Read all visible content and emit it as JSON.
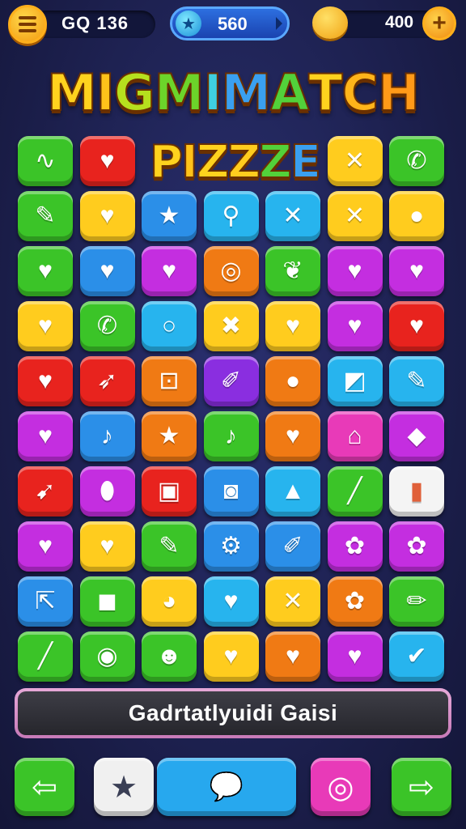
{
  "header": {
    "score_text": "GQ 136",
    "gems_value": "560",
    "coins_value": "400",
    "menu_icon": "hamburger-menu-icon",
    "gem_icon": "star-gem-icon",
    "coin_icon": "gold-coin-icon",
    "plus_label": "+"
  },
  "title": {
    "line1": "MIGMIMATCH",
    "line2": "PIZZZE"
  },
  "board": {
    "rows": 10,
    "cols": 7,
    "tiles": [
      [
        {
          "color": "#3bc428",
          "icon": "swirl-icon",
          "glyph": "∿"
        },
        {
          "color": "#e8231e",
          "icon": "heart-icon",
          "glyph": "♥"
        },
        {
          "color": "#ffd418",
          "icon": "title-overlap",
          "glyph": ""
        },
        {
          "color": "#ffd418",
          "icon": "title-overlap",
          "glyph": ""
        },
        {
          "color": "#ffd418",
          "icon": "title-overlap",
          "glyph": ""
        },
        {
          "color": "#ffcc1e",
          "icon": "cross-icon",
          "glyph": "✕"
        },
        {
          "color": "#3bc428",
          "icon": "phone-icon",
          "glyph": "✆"
        }
      ],
      [
        {
          "color": "#3bc428",
          "icon": "pencil-icon",
          "glyph": "✎"
        },
        {
          "color": "#ffcc1e",
          "icon": "heart-icon",
          "glyph": "♥"
        },
        {
          "color": "#2b8fe8",
          "icon": "star-icon",
          "glyph": "★"
        },
        {
          "color": "#27b4ee",
          "icon": "magnify-icon",
          "glyph": "⚲"
        },
        {
          "color": "#27b4ee",
          "icon": "cross-icon",
          "glyph": "✕"
        },
        {
          "color": "#ffcc1e",
          "icon": "cross-icon",
          "glyph": "✕"
        },
        {
          "color": "#ffcc1e",
          "icon": "leaf-icon",
          "glyph": "●"
        }
      ],
      [
        {
          "color": "#3bc428",
          "icon": "heart-icon",
          "glyph": "♥"
        },
        {
          "color": "#2b8fe8",
          "icon": "heart-icon",
          "glyph": "♥"
        },
        {
          "color": "#c42ee0",
          "icon": "heart-icon",
          "glyph": "♥"
        },
        {
          "color": "#f07a14",
          "icon": "ring-icon",
          "glyph": "◎"
        },
        {
          "color": "#3bc428",
          "icon": "leaf-icon",
          "glyph": "❦"
        },
        {
          "color": "#c42ee0",
          "icon": "heart-icon",
          "glyph": "♥"
        },
        {
          "color": "#c42ee0",
          "icon": "heart-icon",
          "glyph": "♥"
        }
      ],
      [
        {
          "color": "#ffcc1e",
          "icon": "heart-icon",
          "glyph": "♥"
        },
        {
          "color": "#3bc428",
          "icon": "phone-icon",
          "glyph": "✆"
        },
        {
          "color": "#27b4ee",
          "icon": "circle-icon",
          "glyph": "○"
        },
        {
          "color": "#ffcc1e",
          "icon": "bow-icon",
          "glyph": "✖"
        },
        {
          "color": "#ffcc1e",
          "icon": "heart-icon",
          "glyph": "♥"
        },
        {
          "color": "#c42ee0",
          "icon": "heart-icon",
          "glyph": "♥"
        },
        {
          "color": "#e8231e",
          "icon": "heart-icon",
          "glyph": "♥"
        }
      ],
      [
        {
          "color": "#e8231e",
          "icon": "heart-icon",
          "glyph": "♥"
        },
        {
          "color": "#e8231e",
          "icon": "arrow-icon",
          "glyph": "➶"
        },
        {
          "color": "#f07a14",
          "icon": "lock-icon",
          "glyph": "⊡"
        },
        {
          "color": "#8a2ee0",
          "icon": "brush-icon",
          "glyph": "✐"
        },
        {
          "color": "#f07a14",
          "icon": "balloon-icon",
          "glyph": "●"
        },
        {
          "color": "#27b4ee",
          "icon": "note-icon",
          "glyph": "◩"
        },
        {
          "color": "#27b4ee",
          "icon": "pen-icon",
          "glyph": "✎"
        }
      ],
      [
        {
          "color": "#c42ee0",
          "icon": "heart-icon",
          "glyph": "♥"
        },
        {
          "color": "#2b8fe8",
          "icon": "music-note-icon",
          "glyph": "♪"
        },
        {
          "color": "#f07a14",
          "icon": "star-icon",
          "glyph": "★"
        },
        {
          "color": "#3bc428",
          "icon": "music-note-icon",
          "glyph": "♪"
        },
        {
          "color": "#f07a14",
          "icon": "heart-icon",
          "glyph": "♥"
        },
        {
          "color": "#e83ab8",
          "icon": "house-icon",
          "glyph": "⌂"
        },
        {
          "color": "#c42ee0",
          "icon": "tag-icon",
          "glyph": "◆"
        }
      ],
      [
        {
          "color": "#e8231e",
          "icon": "bird-icon",
          "glyph": "➹"
        },
        {
          "color": "#c42ee0",
          "icon": "capsule-icon",
          "glyph": "⬮"
        },
        {
          "color": "#e8231e",
          "icon": "face-icon",
          "glyph": "▣"
        },
        {
          "color": "#2b8fe8",
          "icon": "camera-icon",
          "glyph": "◙"
        },
        {
          "color": "#27b4ee",
          "icon": "bag-icon",
          "glyph": "▲"
        },
        {
          "color": "#3bc428",
          "icon": "pencil-icon",
          "glyph": "╱"
        },
        {
          "color": "#f4f4f4",
          "icon": "book-icon",
          "glyph": "▮"
        }
      ],
      [
        {
          "color": "#c42ee0",
          "icon": "heart-icon",
          "glyph": "♥"
        },
        {
          "color": "#ffcc1e",
          "icon": "heart-icon",
          "glyph": "♥"
        },
        {
          "color": "#3bc428",
          "icon": "pencil-icon",
          "glyph": "✎"
        },
        {
          "color": "#2b8fe8",
          "icon": "gear-icon",
          "glyph": "⚙"
        },
        {
          "color": "#2b8fe8",
          "icon": "brush-icon",
          "glyph": "✐"
        },
        {
          "color": "#c42ee0",
          "icon": "flower-icon",
          "glyph": "✿"
        },
        {
          "color": "#c42ee0",
          "icon": "flower-icon",
          "glyph": "✿"
        }
      ],
      [
        {
          "color": "#2b8fe8",
          "icon": "share-icon",
          "glyph": "⇱"
        },
        {
          "color": "#3bc428",
          "icon": "bag-icon",
          "glyph": "◼"
        },
        {
          "color": "#ffcc1e",
          "icon": "pig-icon",
          "glyph": "◕"
        },
        {
          "color": "#27b4ee",
          "icon": "heart-icon",
          "glyph": "♥"
        },
        {
          "color": "#ffcc1e",
          "icon": "cross-icon",
          "glyph": "✕"
        },
        {
          "color": "#f07a14",
          "icon": "flower-icon",
          "glyph": "✿"
        },
        {
          "color": "#3bc428",
          "icon": "pencil-icon",
          "glyph": "✏"
        }
      ],
      [
        {
          "color": "#3bc428",
          "icon": "pencil-icon",
          "glyph": "╱"
        },
        {
          "color": "#3bc428",
          "icon": "ring-icon",
          "glyph": "◉"
        },
        {
          "color": "#3bc428",
          "icon": "robot-icon",
          "glyph": "☻"
        },
        {
          "color": "#ffcc1e",
          "icon": "heart-icon",
          "glyph": "♥"
        },
        {
          "color": "#f07a14",
          "icon": "heart-icon",
          "glyph": "♥"
        },
        {
          "color": "#c42ee0",
          "icon": "heart-icon",
          "glyph": "♥"
        },
        {
          "color": "#27b4ee",
          "icon": "check-icon",
          "glyph": "✔"
        }
      ]
    ]
  },
  "message": {
    "text": "Gadrtatlyuidi Gaisi"
  },
  "footer": {
    "buttons": [
      {
        "name": "back-button",
        "icon": "arrow-left-icon",
        "glyph": "⇦",
        "color": "#3bc428"
      },
      {
        "name": "favorite-button",
        "icon": "star-icon",
        "glyph": "★",
        "color": "#f0f0f0"
      },
      {
        "name": "chat-button",
        "icon": "chat-bubble-icon",
        "glyph": "💬",
        "color": "#27a8ee"
      },
      {
        "name": "settings-button",
        "icon": "ring-camera-icon",
        "glyph": "◎",
        "color": "#e83ab8"
      },
      {
        "name": "next-button",
        "icon": "arrow-right-icon",
        "glyph": "⇨",
        "color": "#3bc428"
      }
    ]
  }
}
